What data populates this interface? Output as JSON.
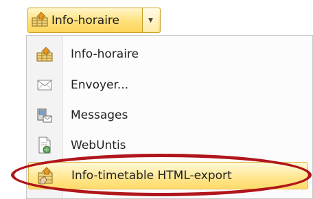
{
  "button": {
    "label": "Info-horaire",
    "icon": "timetable-house-icon",
    "arrow_icon": "chevron-down-icon"
  },
  "menu": {
    "items": [
      {
        "label": "Info-horaire",
        "icon": "timetable-house-icon"
      },
      {
        "label": "Envoyer...",
        "icon": "envelope-icon"
      },
      {
        "label": "Messages",
        "icon": "messages-icon"
      },
      {
        "label": "WebUntis",
        "icon": "web-document-icon"
      },
      {
        "label": "Info-timetable HTML-export",
        "icon": "html-export-icon",
        "highlighted": true
      }
    ]
  },
  "colors": {
    "highlight": "#ffe58c",
    "annotation_ring": "#b0161b"
  }
}
